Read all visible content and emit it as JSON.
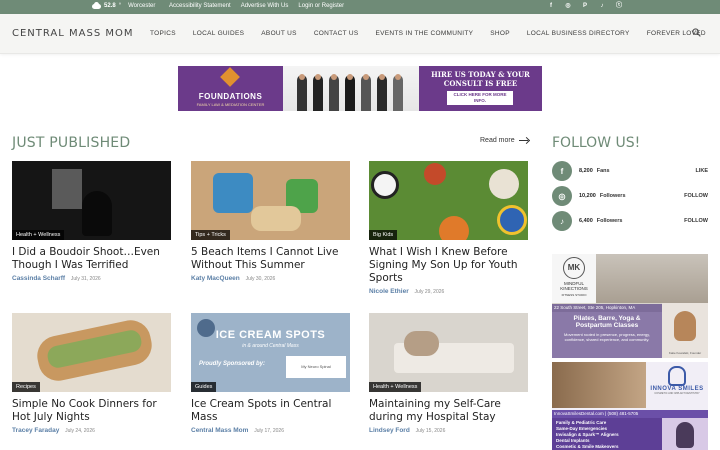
{
  "topbar": {
    "temperature": "52.8",
    "degree": "°",
    "city": "Worcester",
    "links": [
      "Accessibility Statement",
      "Advertise With Us",
      "Login or Register"
    ],
    "social": [
      "f",
      "◎",
      "P",
      "♪",
      "ⓣ"
    ]
  },
  "nav": {
    "logo": "CENTRAL MASS MOM",
    "items": [
      "TOPICS",
      "LOCAL GUIDES",
      "ABOUT US",
      "CONTACT US",
      "EVENTS IN THE COMMUNITY",
      "SHOP",
      "LOCAL BUSINESS DIRECTORY",
      "FOREVER LOVED"
    ]
  },
  "banner": {
    "left_title": "FOUNDATIONS",
    "left_sub": "FAMILY LAW & MEDIATION CENTER",
    "right_line1": "HIRE US TODAY & YOUR",
    "right_line2": "CONSULT IS FREE",
    "right_button": "CLICK HERE FOR MORE INFO."
  },
  "just_published": {
    "title": "JUST PUBLISHED",
    "read_more": "Read more",
    "posts": [
      {
        "tag": "Health + Wellness",
        "title": "I Did a Boudoir Shoot…Even Though I Was Terrified",
        "author": "Cassinda Scharff",
        "date": "July 31, 2026"
      },
      {
        "tag": "Tips + Tricks",
        "title": "5 Beach Items I Cannot Live Without This Summer",
        "author": "Katy MacQueen",
        "date": "July 30, 2026"
      },
      {
        "tag": "Big Kids",
        "title": "What I Wish I Knew Before Signing My Son Up for Youth Sports",
        "author": "Nicole Ethier",
        "date": "July 29, 2026"
      },
      {
        "tag": "Recipes",
        "title": "Simple No Cook Dinners for Hot July Nights",
        "author": "Tracey Faraday",
        "date": "July 24, 2026"
      },
      {
        "tag": "Guides",
        "title": "Ice Cream Spots in Central Mass",
        "author": "Central Mass Mom",
        "date": "July 17, 2026"
      },
      {
        "tag": "Health + Wellness",
        "title": "Maintaining my Self-Care during my Hospital Stay",
        "author": "Lindsey Ford",
        "date": "July 15, 2026"
      }
    ],
    "ice_cream_thumb": {
      "heading": "ICE CREAM SPOTS",
      "subheading": "in & around Central Mass",
      "sponsor_text": "Proudly Sponsored by:",
      "sponsor_name": "My Neuro Spinal"
    }
  },
  "follow": {
    "title": "FOLLOW US!",
    "rows": [
      {
        "icon": "f",
        "count": "8,200",
        "label": "Fans",
        "action": "LIKE"
      },
      {
        "icon": "◎",
        "count": "10,200",
        "label": "Followers",
        "action": "FOLLOW"
      },
      {
        "icon": "♪",
        "count": "6,400",
        "label": "Followers",
        "action": "FOLLOW"
      }
    ]
  },
  "ads": {
    "mindful": {
      "mark": "MK",
      "brand": "MINDFUL KINECTIONS",
      "tagline": "FITNESS STUDIO",
      "address": "22 South Street, Ste 205, Hopkinton, MA",
      "line1": "Pilates, Barre, Yoga &",
      "line2": "Postpartum Classes",
      "desc": "Movement rooted in presence, progress, energy, confidence, shared experience, and community.",
      "caption": "Katie Kowalski, Founder"
    },
    "innova": {
      "name": "INNOVA SMILES",
      "sub": "COSMETIC AND IMPLANT DENTISTRY",
      "url": "InnovaSmilesDental.com | (508) 481-5705",
      "services": [
        "Family & Pediatric Care",
        "Same-Day Emergencies",
        "Invisalign & Spark™ Aligners",
        "Dental Implants",
        "Cosmetic & Smile Makeovers"
      ]
    }
  },
  "colors": {
    "accent_green": "#6f8b77",
    "author_blue": "#5b7fa6",
    "purple": "#6b3a8a"
  }
}
